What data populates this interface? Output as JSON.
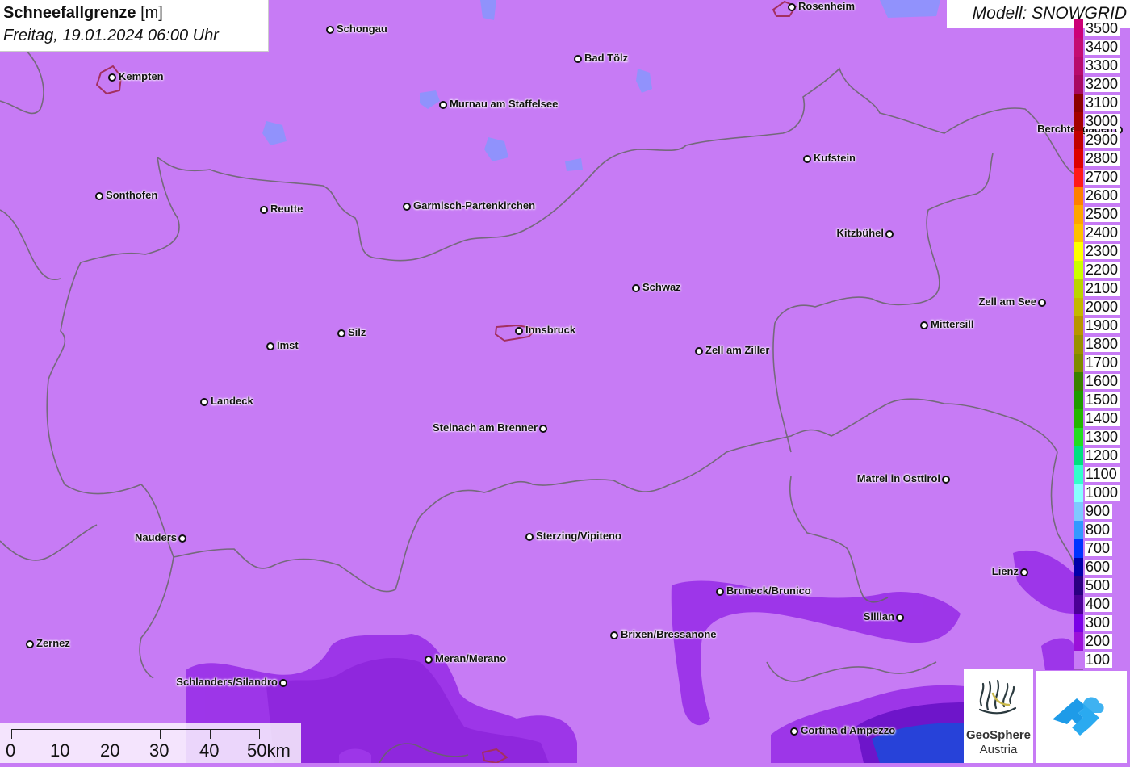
{
  "title": {
    "variable": "Schneefallgrenze",
    "unit": "[m]",
    "datetime": "Freitag, 19.01.2024 06:00 Uhr"
  },
  "model": "Modell: SNOWGRID",
  "legend": [
    {
      "label": "3500",
      "color": "#cc0077"
    },
    {
      "label": "3400",
      "color": "#c40c72"
    },
    {
      "label": "3300",
      "color": "#b80a6c"
    },
    {
      "label": "3200",
      "color": "#a80860"
    },
    {
      "label": "3100",
      "color": "#8b0000"
    },
    {
      "label": "3000",
      "color": "#a30000"
    },
    {
      "label": "2900",
      "color": "#c10000"
    },
    {
      "label": "2800",
      "color": "#dd0000"
    },
    {
      "label": "2700",
      "color": "#ff1a1a"
    },
    {
      "label": "2600",
      "color": "#ff8000"
    },
    {
      "label": "2500",
      "color": "#ffa500"
    },
    {
      "label": "2400",
      "color": "#ffc000"
    },
    {
      "label": "2300",
      "color": "#ffff00"
    },
    {
      "label": "2200",
      "color": "#ccff00"
    },
    {
      "label": "2100",
      "color": "#bbd400"
    },
    {
      "label": "2000",
      "color": "#c4b800"
    },
    {
      "label": "1900",
      "color": "#b89500"
    },
    {
      "label": "1800",
      "color": "#9a9000"
    },
    {
      "label": "1700",
      "color": "#7f8a00"
    },
    {
      "label": "1600",
      "color": "#3a8000"
    },
    {
      "label": "1500",
      "color": "#1e9a00"
    },
    {
      "label": "1400",
      "color": "#22b500"
    },
    {
      "label": "1300",
      "color": "#22dd22"
    },
    {
      "label": "1200",
      "color": "#00e080"
    },
    {
      "label": "1100",
      "color": "#33ffcc"
    },
    {
      "label": "1000",
      "color": "#88ffff"
    },
    {
      "label": "900",
      "color": "#7fc8ff"
    },
    {
      "label": "800",
      "color": "#3399ff"
    },
    {
      "label": "700",
      "color": "#0033ff"
    },
    {
      "label": "600",
      "color": "#0000aa"
    },
    {
      "label": "500",
      "color": "#2a0080"
    },
    {
      "label": "400",
      "color": "#4b0096"
    },
    {
      "label": "300",
      "color": "#7a00e6"
    },
    {
      "label": "200",
      "color": "#9b11d9"
    },
    {
      "label": "100",
      "color": "#c77bf5"
    }
  ],
  "cities": [
    {
      "name": "Schongau",
      "label_side": "right"
    },
    {
      "name": "Rosenheim",
      "label_side": "right"
    },
    {
      "name": "Kempten",
      "label_side": "right"
    },
    {
      "name": "Bad Tölz",
      "label_side": "right"
    },
    {
      "name": "Murnau am Staffelsee",
      "label_side": "right"
    },
    {
      "name": "Berchtesgaden",
      "label_side": "left"
    },
    {
      "name": "Kufstein",
      "label_side": "right"
    },
    {
      "name": "Sonthofen",
      "label_side": "right"
    },
    {
      "name": "Reutte",
      "label_side": "right"
    },
    {
      "name": "Garmisch-Partenkirchen",
      "label_side": "right"
    },
    {
      "name": "Kitzbühel",
      "label_side": "left"
    },
    {
      "name": "Schwaz",
      "label_side": "right"
    },
    {
      "name": "Zell am See",
      "label_side": "left"
    },
    {
      "name": "Mittersill",
      "label_side": "right"
    },
    {
      "name": "Innsbruck",
      "label_side": "right"
    },
    {
      "name": "Silz",
      "label_side": "right"
    },
    {
      "name": "Imst",
      "label_side": "right"
    },
    {
      "name": "Zell am Ziller",
      "label_side": "right"
    },
    {
      "name": "Landeck",
      "label_side": "right"
    },
    {
      "name": "Steinach am Brenner",
      "label_side": "left"
    },
    {
      "name": "Matrei in Osttirol",
      "label_side": "left"
    },
    {
      "name": "Nauders",
      "label_side": "left"
    },
    {
      "name": "Sterzing/Vipiteno",
      "label_side": "right"
    },
    {
      "name": "Lienz",
      "label_side": "left"
    },
    {
      "name": "Bruneck/Brunico",
      "label_side": "right"
    },
    {
      "name": "Sillian",
      "label_side": "left"
    },
    {
      "name": "Brixen/Bressanone",
      "label_side": "right"
    },
    {
      "name": "Zernez",
      "label_side": "right"
    },
    {
      "name": "Meran/Merano",
      "label_side": "right"
    },
    {
      "name": "Schlanders/Silandro",
      "label_side": "left"
    },
    {
      "name": "Cortina d'Ampezzo",
      "label_side": "right"
    }
  ],
  "scale": {
    "labels": [
      "0",
      "10",
      "20",
      "30",
      "40",
      "50km"
    ]
  },
  "logos": {
    "geosphere_line1": "GeoSphere",
    "geosphere_line2": "Austria"
  }
}
